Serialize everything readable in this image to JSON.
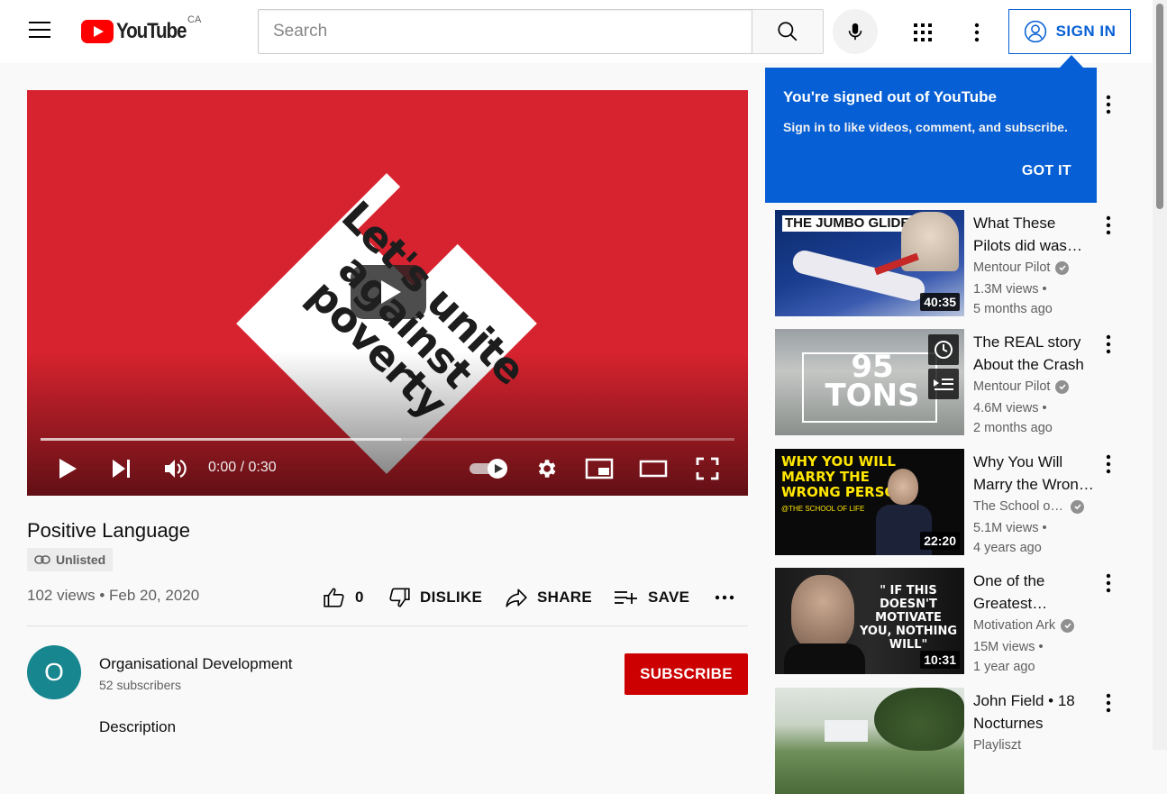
{
  "header": {
    "logo_text": "YouTube",
    "region": "CA",
    "search_placeholder": "Search",
    "signin_label": "SIGN IN"
  },
  "player": {
    "overlay_text": "Let's unite against poverty",
    "time": "0:00 / 0:30",
    "progress_fraction": 0.52
  },
  "video": {
    "title": "Positive Language",
    "badge": "Unlisted",
    "views_date": "102 views • Feb 20, 2020",
    "like_count": "0",
    "dislike_label": "DISLIKE",
    "share_label": "SHARE",
    "save_label": "SAVE"
  },
  "channel": {
    "avatar_letter": "O",
    "name": "Organisational Development",
    "subscribers": "52 subscribers",
    "subscribe_label": "SUBSCRIBE",
    "description_label": "Description"
  },
  "popup": {
    "title": "You're signed out of YouTube",
    "body": "Sign in to like videos, comment, and subscribe.",
    "button": "GOT IT"
  },
  "recommendations": [
    {
      "title": "What These Pilots did was Incredible",
      "channel": "Mentour Pilot",
      "verified": true,
      "views": "1.3M views •",
      "age": "5 months ago",
      "duration": "40:35",
      "thumb_text": "THE JUMBO GLIDER"
    },
    {
      "title": "The REAL story About the Crash",
      "channel": "Mentour Pilot",
      "verified": true,
      "views": "4.6M views •",
      "age": "2 months ago",
      "duration": "",
      "thumb_text": "95 TONS"
    },
    {
      "title": "Why You Will Marry the Wrong Person",
      "channel": "The School of Life",
      "verified": true,
      "views": "5.1M views •",
      "age": "4 years ago",
      "duration": "22:20",
      "thumb_text": "WHY YOU WILL MARRY THE WRONG PERSON",
      "thumb_sub": "@THE SCHOOL OF LIFE"
    },
    {
      "title": "One of the Greatest Speeches Ever",
      "channel": "Motivation Ark",
      "verified": true,
      "views": "15M views •",
      "age": "1 year ago",
      "duration": "10:31",
      "thumb_text": "\" IF THIS DOESN'T MOTIVATE YOU, NOTHING WILL\""
    },
    {
      "title": "John Field • 18 Nocturnes",
      "channel": "Playliszt",
      "verified": false,
      "views": "",
      "age": "",
      "duration": ""
    }
  ],
  "colors": {
    "brand_red": "#ff0000",
    "accent_blue": "#065fd4",
    "subscribe_red": "#cc0000",
    "player_bg": "#d7232f",
    "avatar_teal": "#17868f"
  }
}
